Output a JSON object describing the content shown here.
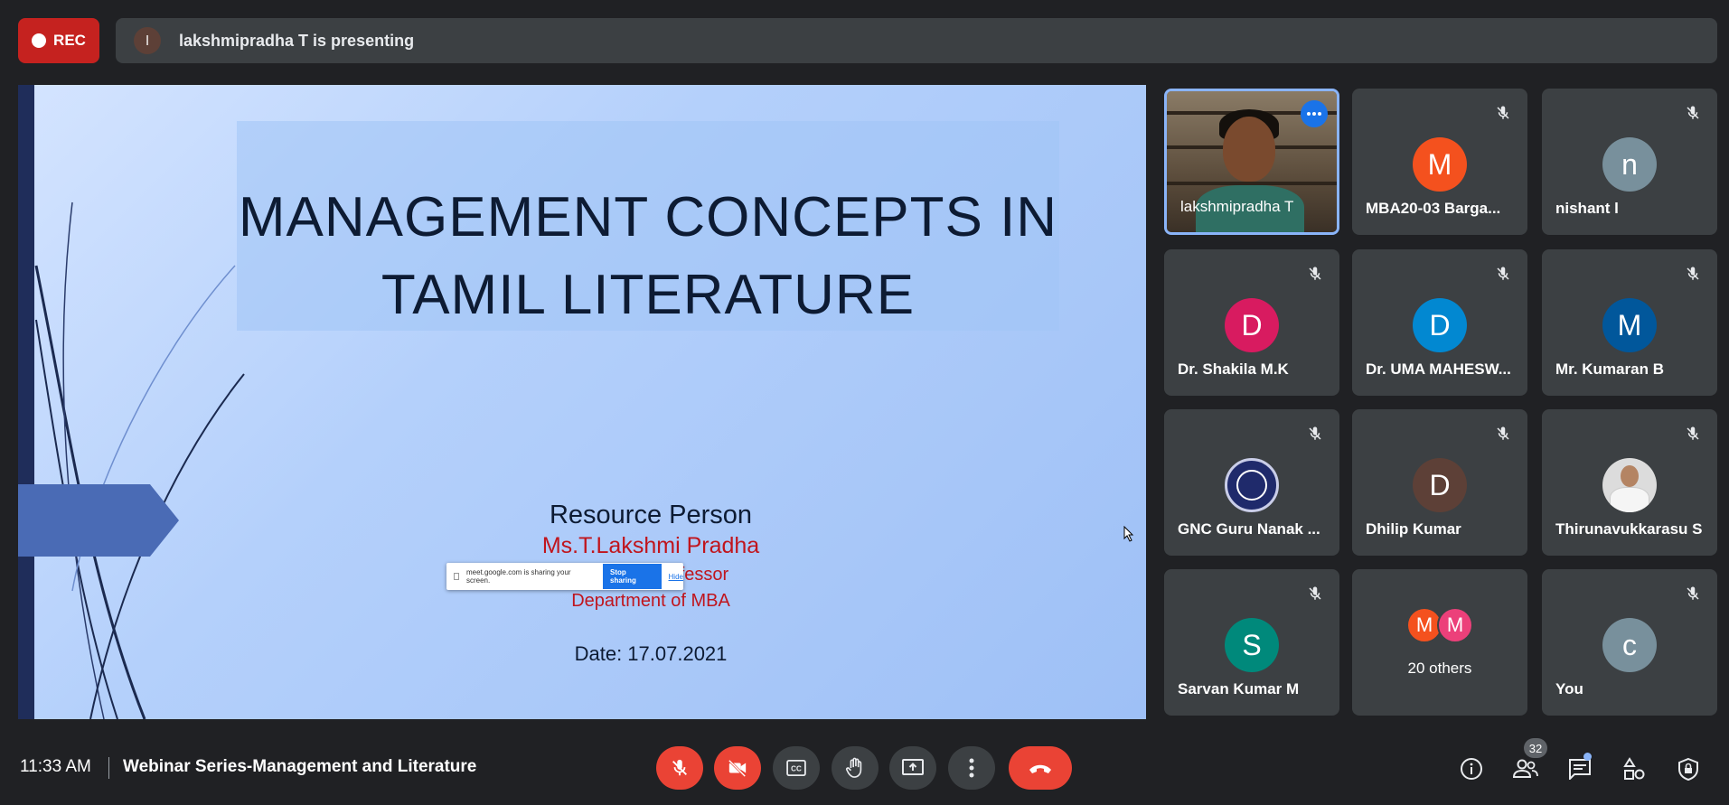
{
  "recording": {
    "label": "REC",
    "color": "#c5221f"
  },
  "presenting_banner": {
    "avatar_letter": "l",
    "text": "lakshmipradha T is presenting"
  },
  "slide": {
    "title_line1": "MANAGEMENT CONCEPTS IN",
    "title_line2": "TAMIL LITERATURE",
    "resource_label": "Resource Person",
    "resource_name": "Ms.T.Lakshmi Pradha",
    "resource_role": "Assistant Professor",
    "resource_dept": "Department of MBA",
    "date_text": "Date: 17.07.2021"
  },
  "share_popup": {
    "message": "meet.google.com is sharing your screen.",
    "stop_label": "Stop sharing",
    "hide_label": "Hide"
  },
  "participants": [
    {
      "name": "lakshmipradha T",
      "type": "video",
      "speaking": true
    },
    {
      "name": "MBA20-03 Barga...",
      "letter": "M",
      "color": "#f4511e",
      "muted": true
    },
    {
      "name": "nishant l",
      "letter": "n",
      "color": "#78909c",
      "muted": true
    },
    {
      "name": "Dr. Shakila M.K",
      "letter": "D",
      "color": "#d81b60",
      "muted": true
    },
    {
      "name": "Dr. UMA MAHESW...",
      "letter": "D",
      "color": "#0288d1",
      "muted": true
    },
    {
      "name": "Mr. Kumaran B",
      "letter": "M",
      "color": "#01579b",
      "muted": true
    },
    {
      "name": "GNC Guru Nanak ...",
      "type": "logo",
      "muted": true
    },
    {
      "name": "Dhilip Kumar",
      "letter": "D",
      "color": "#5d4037",
      "muted": true
    },
    {
      "name": "Thirunavukkarasu S",
      "type": "photo",
      "muted": true
    },
    {
      "name": "Sarvan Kumar M",
      "letter": "S",
      "color": "#00897b",
      "muted": true
    }
  ],
  "others_tile": {
    "letters": [
      "M",
      "M"
    ],
    "colors": [
      "#f4511e",
      "#ec407a"
    ],
    "label": "20 others"
  },
  "self_tile": {
    "name": "You",
    "letter": "c",
    "color": "#78909c",
    "muted": true
  },
  "bottom": {
    "time": "11:33 AM",
    "meeting_title": "Webinar Series-Management and Literature",
    "participant_count": "32"
  },
  "icons": [
    "mic-off-icon",
    "camera-off-icon",
    "captions-icon",
    "raise-hand-icon",
    "present-screen-icon",
    "more-options-icon",
    "hang-up-icon",
    "info-icon",
    "people-icon",
    "chat-icon",
    "activities-icon",
    "host-controls-icon"
  ]
}
